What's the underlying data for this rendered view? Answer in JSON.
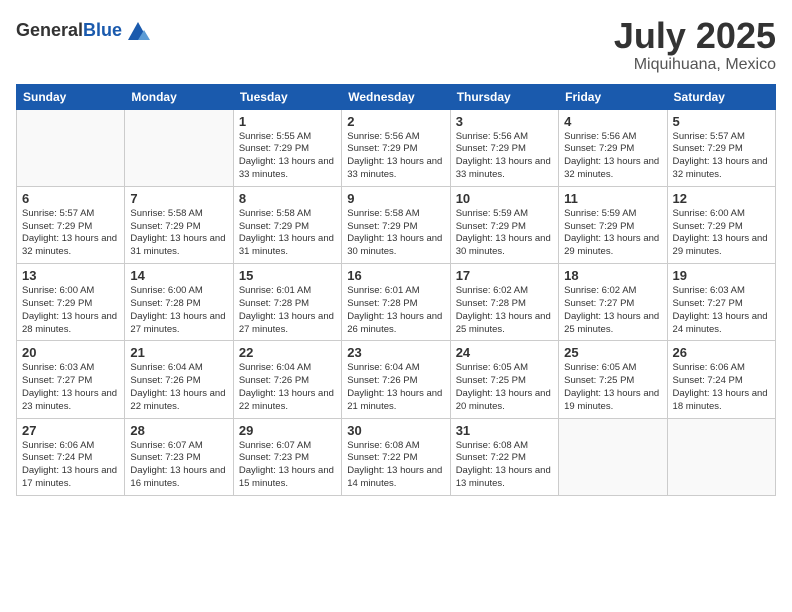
{
  "header": {
    "logo_general": "General",
    "logo_blue": "Blue",
    "month": "July 2025",
    "location": "Miquihuana, Mexico"
  },
  "days_of_week": [
    "Sunday",
    "Monday",
    "Tuesday",
    "Wednesday",
    "Thursday",
    "Friday",
    "Saturday"
  ],
  "weeks": [
    [
      {
        "day": "",
        "info": ""
      },
      {
        "day": "",
        "info": ""
      },
      {
        "day": "1",
        "info": "Sunrise: 5:55 AM\nSunset: 7:29 PM\nDaylight: 13 hours and 33 minutes."
      },
      {
        "day": "2",
        "info": "Sunrise: 5:56 AM\nSunset: 7:29 PM\nDaylight: 13 hours and 33 minutes."
      },
      {
        "day": "3",
        "info": "Sunrise: 5:56 AM\nSunset: 7:29 PM\nDaylight: 13 hours and 33 minutes."
      },
      {
        "day": "4",
        "info": "Sunrise: 5:56 AM\nSunset: 7:29 PM\nDaylight: 13 hours and 32 minutes."
      },
      {
        "day": "5",
        "info": "Sunrise: 5:57 AM\nSunset: 7:29 PM\nDaylight: 13 hours and 32 minutes."
      }
    ],
    [
      {
        "day": "6",
        "info": "Sunrise: 5:57 AM\nSunset: 7:29 PM\nDaylight: 13 hours and 32 minutes."
      },
      {
        "day": "7",
        "info": "Sunrise: 5:58 AM\nSunset: 7:29 PM\nDaylight: 13 hours and 31 minutes."
      },
      {
        "day": "8",
        "info": "Sunrise: 5:58 AM\nSunset: 7:29 PM\nDaylight: 13 hours and 31 minutes."
      },
      {
        "day": "9",
        "info": "Sunrise: 5:58 AM\nSunset: 7:29 PM\nDaylight: 13 hours and 30 minutes."
      },
      {
        "day": "10",
        "info": "Sunrise: 5:59 AM\nSunset: 7:29 PM\nDaylight: 13 hours and 30 minutes."
      },
      {
        "day": "11",
        "info": "Sunrise: 5:59 AM\nSunset: 7:29 PM\nDaylight: 13 hours and 29 minutes."
      },
      {
        "day": "12",
        "info": "Sunrise: 6:00 AM\nSunset: 7:29 PM\nDaylight: 13 hours and 29 minutes."
      }
    ],
    [
      {
        "day": "13",
        "info": "Sunrise: 6:00 AM\nSunset: 7:29 PM\nDaylight: 13 hours and 28 minutes."
      },
      {
        "day": "14",
        "info": "Sunrise: 6:00 AM\nSunset: 7:28 PM\nDaylight: 13 hours and 27 minutes."
      },
      {
        "day": "15",
        "info": "Sunrise: 6:01 AM\nSunset: 7:28 PM\nDaylight: 13 hours and 27 minutes."
      },
      {
        "day": "16",
        "info": "Sunrise: 6:01 AM\nSunset: 7:28 PM\nDaylight: 13 hours and 26 minutes."
      },
      {
        "day": "17",
        "info": "Sunrise: 6:02 AM\nSunset: 7:28 PM\nDaylight: 13 hours and 25 minutes."
      },
      {
        "day": "18",
        "info": "Sunrise: 6:02 AM\nSunset: 7:27 PM\nDaylight: 13 hours and 25 minutes."
      },
      {
        "day": "19",
        "info": "Sunrise: 6:03 AM\nSunset: 7:27 PM\nDaylight: 13 hours and 24 minutes."
      }
    ],
    [
      {
        "day": "20",
        "info": "Sunrise: 6:03 AM\nSunset: 7:27 PM\nDaylight: 13 hours and 23 minutes."
      },
      {
        "day": "21",
        "info": "Sunrise: 6:04 AM\nSunset: 7:26 PM\nDaylight: 13 hours and 22 minutes."
      },
      {
        "day": "22",
        "info": "Sunrise: 6:04 AM\nSunset: 7:26 PM\nDaylight: 13 hours and 22 minutes."
      },
      {
        "day": "23",
        "info": "Sunrise: 6:04 AM\nSunset: 7:26 PM\nDaylight: 13 hours and 21 minutes."
      },
      {
        "day": "24",
        "info": "Sunrise: 6:05 AM\nSunset: 7:25 PM\nDaylight: 13 hours and 20 minutes."
      },
      {
        "day": "25",
        "info": "Sunrise: 6:05 AM\nSunset: 7:25 PM\nDaylight: 13 hours and 19 minutes."
      },
      {
        "day": "26",
        "info": "Sunrise: 6:06 AM\nSunset: 7:24 PM\nDaylight: 13 hours and 18 minutes."
      }
    ],
    [
      {
        "day": "27",
        "info": "Sunrise: 6:06 AM\nSunset: 7:24 PM\nDaylight: 13 hours and 17 minutes."
      },
      {
        "day": "28",
        "info": "Sunrise: 6:07 AM\nSunset: 7:23 PM\nDaylight: 13 hours and 16 minutes."
      },
      {
        "day": "29",
        "info": "Sunrise: 6:07 AM\nSunset: 7:23 PM\nDaylight: 13 hours and 15 minutes."
      },
      {
        "day": "30",
        "info": "Sunrise: 6:08 AM\nSunset: 7:22 PM\nDaylight: 13 hours and 14 minutes."
      },
      {
        "day": "31",
        "info": "Sunrise: 6:08 AM\nSunset: 7:22 PM\nDaylight: 13 hours and 13 minutes."
      },
      {
        "day": "",
        "info": ""
      },
      {
        "day": "",
        "info": ""
      }
    ]
  ]
}
